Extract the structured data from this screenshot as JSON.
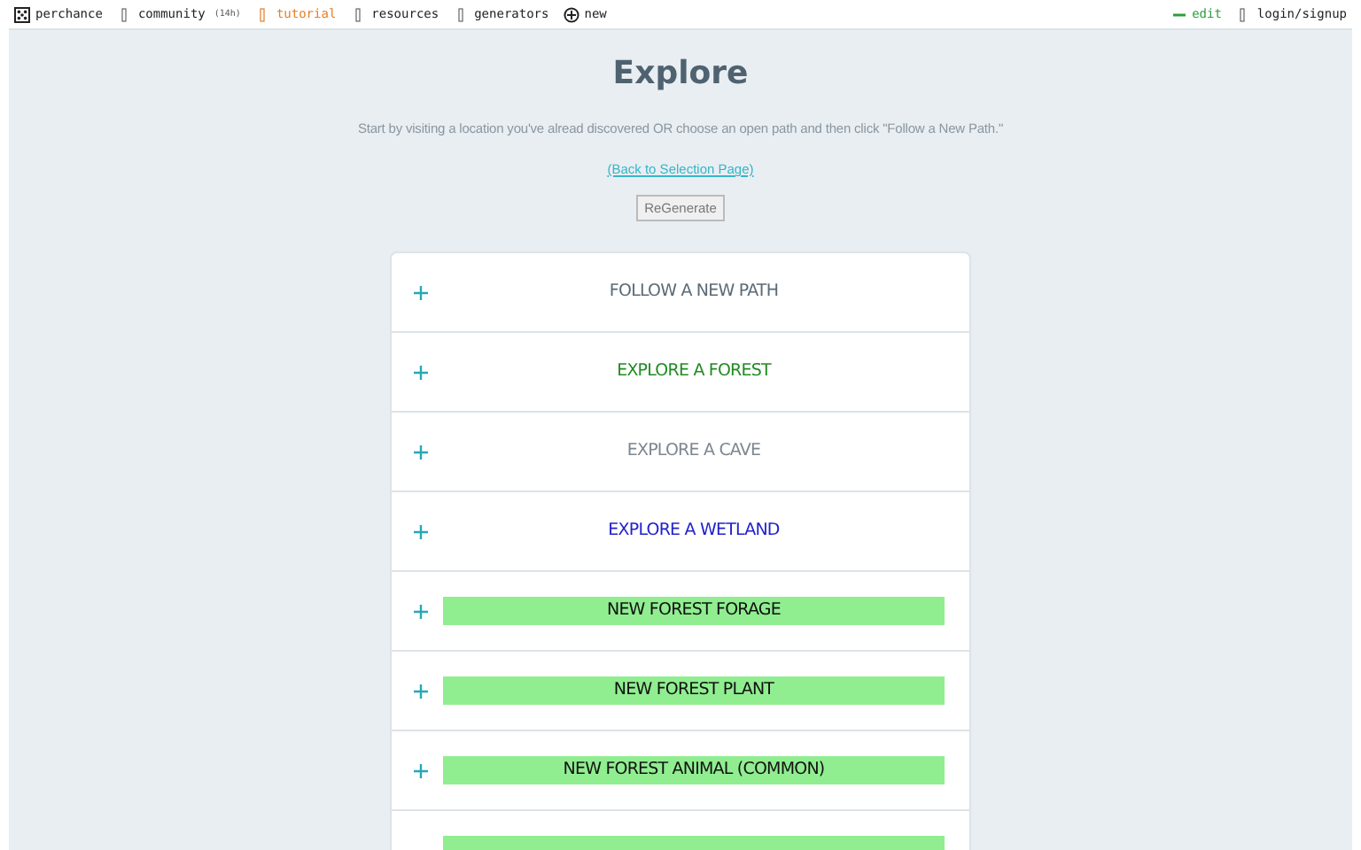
{
  "nav": {
    "left": [
      {
        "kind": "logo",
        "label": "perchance"
      },
      {
        "kind": "item",
        "label": "community",
        "badge": "(14h)"
      },
      {
        "kind": "accent",
        "label": "tutorial",
        "color": "#e67e22"
      },
      {
        "kind": "item",
        "label": "resources"
      },
      {
        "kind": "item",
        "label": "generators"
      },
      {
        "kind": "plus",
        "label": "new"
      }
    ],
    "right": [
      {
        "kind": "accent",
        "label": "edit",
        "color": "#2e9e3e"
      },
      {
        "kind": "item",
        "label": "login/signup"
      }
    ]
  },
  "title": "Explore",
  "intro": "Start by visiting a location you've alread discovered OR choose an open path and then click \"Follow a New Path.\"",
  "back_link": "(Back to Selection Page)",
  "button": "ReGenerate",
  "rows": [
    {
      "kind": "plain",
      "label": "FOLLOW A NEW PATH",
      "color": "#5c6b77"
    },
    {
      "kind": "plain",
      "label": "EXPLORE A FOREST",
      "color": "#228b22"
    },
    {
      "kind": "plain",
      "label": "EXPLORE A CAVE",
      "color": "#7d8791"
    },
    {
      "kind": "plain",
      "label": "EXPLORE A WETLAND",
      "color": "#2222cc"
    },
    {
      "kind": "highlight",
      "label": "NEW FOREST FORAGE"
    },
    {
      "kind": "highlight",
      "label": "NEW FOREST PLANT"
    },
    {
      "kind": "highlight",
      "label": "NEW FOREST ANIMAL (COMMON)"
    },
    {
      "kind": "highlight"
    }
  ]
}
